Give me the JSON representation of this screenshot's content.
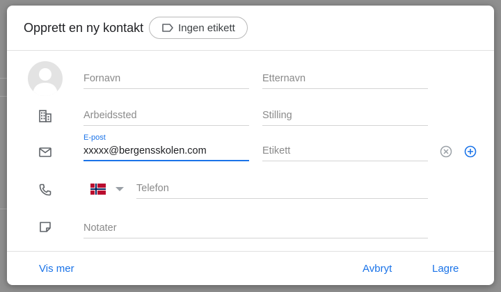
{
  "dialog": {
    "title": "Opprett en ny kontakt",
    "label_chip": "Ingen etikett"
  },
  "fields": {
    "first_name": "Fornavn",
    "last_name": "Etternavn",
    "company": "Arbeidssted",
    "job_title": "Stilling",
    "email_label": "E-post",
    "email_value": "xxxxx@bergensskolen.com",
    "email_tag": "Etikett",
    "phone": "Telefon",
    "notes": "Notater"
  },
  "phone_country": "Norway",
  "footer": {
    "show_more": "Vis mer",
    "cancel": "Avbryt",
    "save": "Lagre"
  },
  "colors": {
    "accent": "#1a73e8",
    "text": "#202124",
    "muted": "#5f6368"
  }
}
